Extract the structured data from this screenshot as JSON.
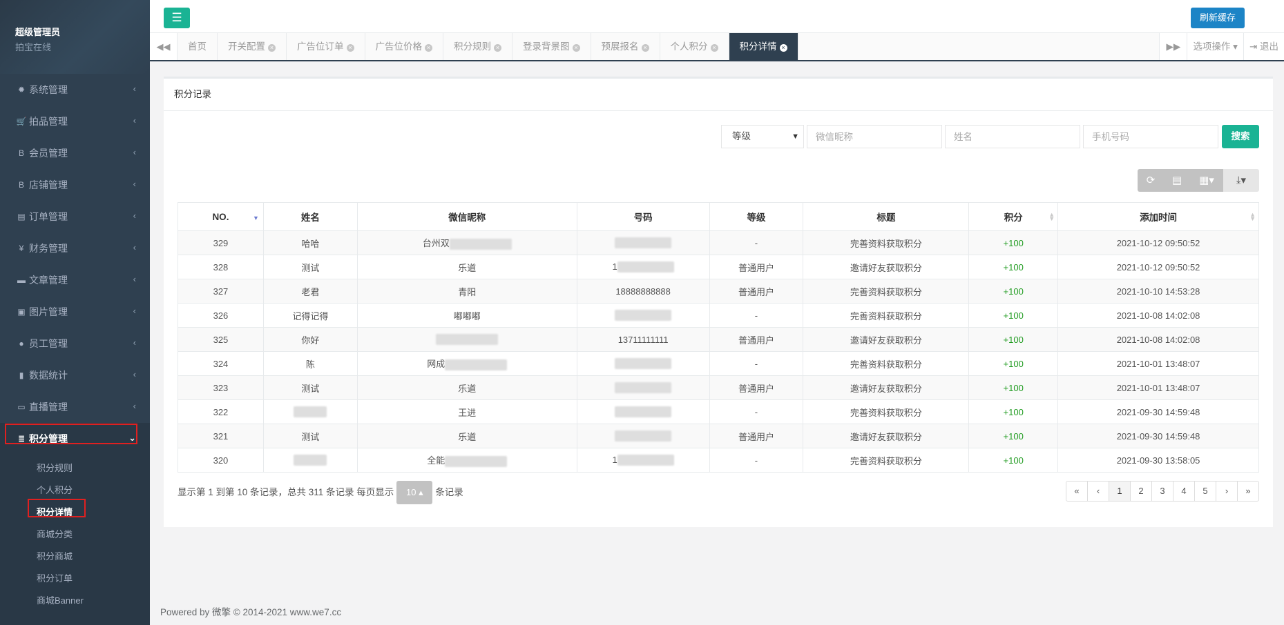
{
  "profile": {
    "name": "超级管理员",
    "subtitle": "拍宝在线"
  },
  "sidebar": {
    "items": [
      {
        "label": "系统管理",
        "icon": "gear-icon",
        "glyph": "✹"
      },
      {
        "label": "拍品管理",
        "icon": "cart-icon",
        "glyph": "🛒"
      },
      {
        "label": "会员管理",
        "icon": "bitcoin-icon",
        "glyph": "B"
      },
      {
        "label": "店铺管理",
        "icon": "bitcoin-icon",
        "glyph": "B"
      },
      {
        "label": "订单管理",
        "icon": "list-icon",
        "glyph": "▤"
      },
      {
        "label": "财务管理",
        "icon": "yen-icon",
        "glyph": "¥"
      },
      {
        "label": "文章管理",
        "icon": "briefcase-icon",
        "glyph": "▬"
      },
      {
        "label": "图片管理",
        "icon": "image-icon",
        "glyph": "▣"
      },
      {
        "label": "员工管理",
        "icon": "user-icon",
        "glyph": "●"
      },
      {
        "label": "数据统计",
        "icon": "bar-chart-icon",
        "glyph": "▮"
      },
      {
        "label": "直播管理",
        "icon": "video-icon",
        "glyph": "▭"
      },
      {
        "label": "积分管理",
        "icon": "database-icon",
        "glyph": "≣"
      }
    ],
    "submenu": [
      "积分规则",
      "个人积分",
      "积分详情",
      "商城分类",
      "积分商城",
      "积分订单",
      "商城Banner"
    ]
  },
  "topbar": {
    "refresh_label": "刷新缓存",
    "menu_glyph": "☰"
  },
  "tabs": [
    "首页",
    "开关配置",
    "广告位订单",
    "广告位价格",
    "积分规则",
    "登录背景图",
    "预展报名",
    "个人积分",
    "积分详情"
  ],
  "tab_right": {
    "options": "选项操作",
    "logout": "退出"
  },
  "panel": {
    "title": "积分记录"
  },
  "search": {
    "level_select": "等级",
    "wechat_placeholder": "微信昵称",
    "name_placeholder": "姓名",
    "phone_placeholder": "手机号码",
    "button": "搜索"
  },
  "table": {
    "columns": [
      "NO.",
      "姓名",
      "微信昵称",
      "号码",
      "等级",
      "标题",
      "积分",
      "添加时间"
    ],
    "rows": [
      {
        "no": "329",
        "name": "哈哈",
        "wechat": "台州双",
        "phone": "",
        "level": "-",
        "title": "完善资料获取积分",
        "score": "+100",
        "time": "2021-10-12 09:50:52"
      },
      {
        "no": "328",
        "name": "测试",
        "wechat": "乐道",
        "phone": "1",
        "level": "普通用户",
        "title": "邀请好友获取积分",
        "score": "+100",
        "time": "2021-10-12 09:50:52"
      },
      {
        "no": "327",
        "name": "老君",
        "wechat": "青阳",
        "phone": "18888888888",
        "level": "普通用户",
        "title": "完善资料获取积分",
        "score": "+100",
        "time": "2021-10-10 14:53:28"
      },
      {
        "no": "326",
        "name": "记得记得",
        "wechat": "嘟嘟嘟",
        "phone": "",
        "level": "-",
        "title": "完善资料获取积分",
        "score": "+100",
        "time": "2021-10-08 14:02:08"
      },
      {
        "no": "325",
        "name": "你好",
        "wechat": "",
        "phone": "13711111111",
        "level": "普通用户",
        "title": "邀请好友获取积分",
        "score": "+100",
        "time": "2021-10-08 14:02:08"
      },
      {
        "no": "324",
        "name": "陈",
        "wechat": "网成",
        "phone": "",
        "level": "-",
        "title": "完善资料获取积分",
        "score": "+100",
        "time": "2021-10-01 13:48:07"
      },
      {
        "no": "323",
        "name": "测试",
        "wechat": "乐道",
        "phone": "",
        "level": "普通用户",
        "title": "邀请好友获取积分",
        "score": "+100",
        "time": "2021-10-01 13:48:07"
      },
      {
        "no": "322",
        "name": "",
        "wechat": "王进",
        "phone": "",
        "level": "-",
        "title": "完善资料获取积分",
        "score": "+100",
        "time": "2021-09-30 14:59:48"
      },
      {
        "no": "321",
        "name": "测试",
        "wechat": "乐道",
        "phone": "",
        "level": "普通用户",
        "title": "邀请好友获取积分",
        "score": "+100",
        "time": "2021-09-30 14:59:48"
      },
      {
        "no": "320",
        "name": "",
        "wechat": "全能",
        "phone": "1",
        "level": "-",
        "title": "完善资料获取积分",
        "score": "+100",
        "time": "2021-09-30 13:58:05"
      }
    ]
  },
  "pager": {
    "info_prefix": "显示第 1 到第 10 条记录，总共 311 条记录 每页显示",
    "page_size": "10",
    "info_suffix": "条记录",
    "pages": [
      "«",
      "‹",
      "1",
      "2",
      "3",
      "4",
      "5",
      "›",
      "»"
    ],
    "active_page": "1"
  },
  "footer": {
    "powered": "Powered by 微擎 © 2014-2021 www.we7.cc"
  },
  "colors": {
    "sidebar": "#2f4050",
    "accent": "#1ab394",
    "primary": "#1c84c6",
    "highlight": "#e02020"
  }
}
